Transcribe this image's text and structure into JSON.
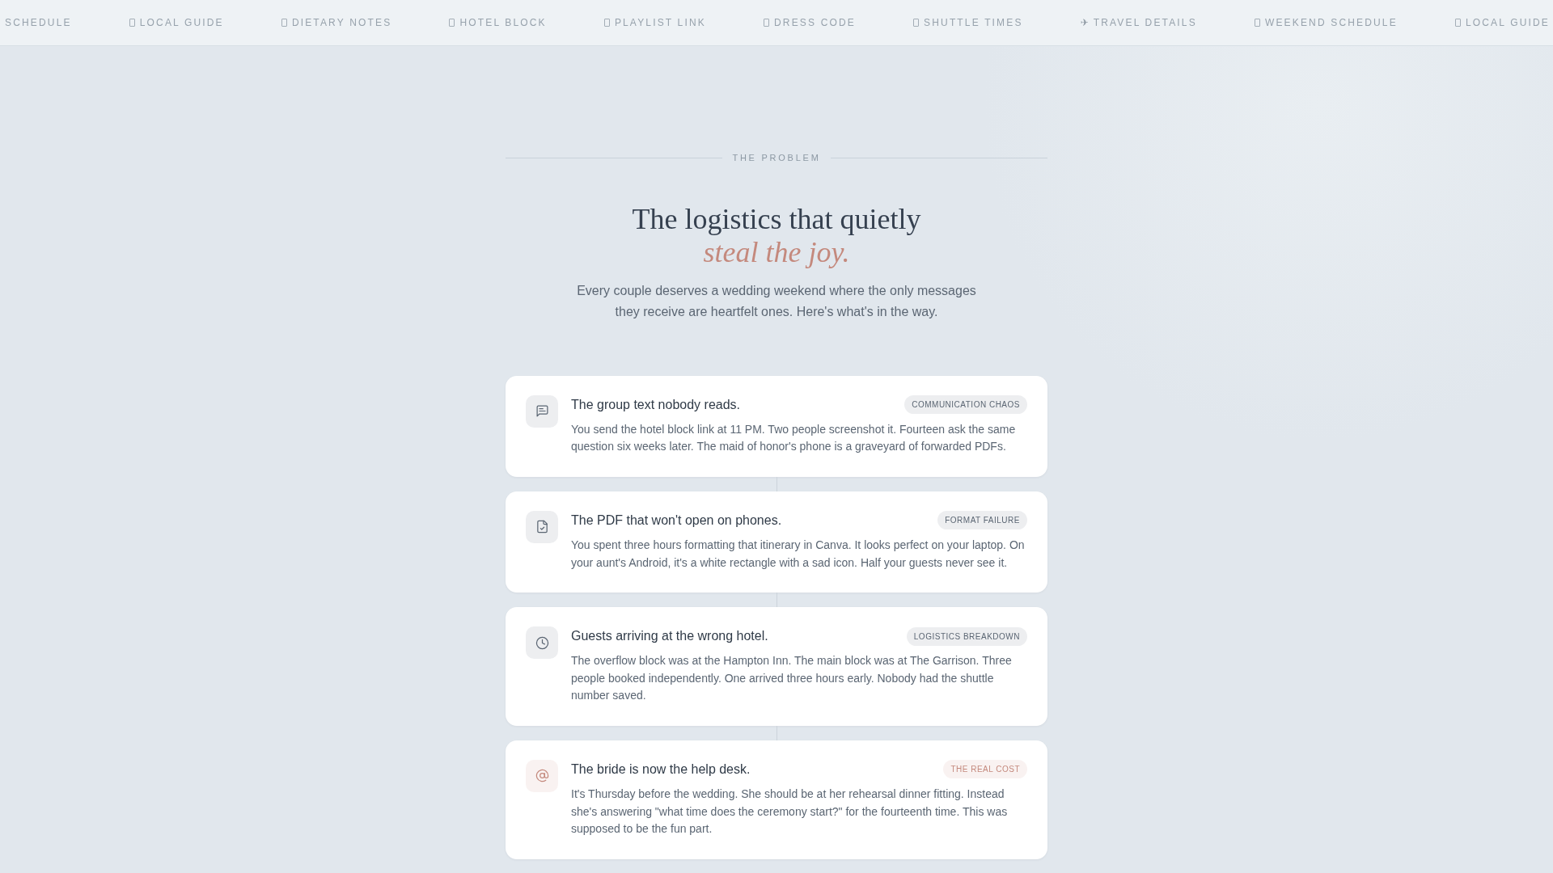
{
  "ticker": {
    "items": [
      {
        "label": "SCHEDULE",
        "kind": "text"
      },
      {
        "label": "LOCAL GUIDE",
        "kind": "box"
      },
      {
        "label": "DIETARY NOTES",
        "kind": "box"
      },
      {
        "label": "HOTEL BLOCK",
        "kind": "box"
      },
      {
        "label": "PLAYLIST LINK",
        "kind": "box"
      },
      {
        "label": "DRESS CODE",
        "kind": "box"
      },
      {
        "label": "SHUTTLE TIMES",
        "kind": "box"
      },
      {
        "label": "TRAVEL DETAILS",
        "kind": "glyph",
        "glyph": "✈"
      },
      {
        "label": "WEEKEND SCHEDULE",
        "kind": "box"
      },
      {
        "label": "LOCAL GUIDE",
        "kind": "box"
      }
    ]
  },
  "section": {
    "eyebrow": "THE PROBLEM",
    "heading": "The logistics that quietly",
    "heading_accent": "steal the joy.",
    "intro": "Every couple deserves a wedding weekend where the only messages they receive are heartfelt ones. Here's what's in the way."
  },
  "cards": [
    {
      "title": "The group text nobody reads.",
      "tag": "COMMUNICATION CHAOS",
      "color": "#5b6673",
      "text": "You send the hotel block link at 11 PM. Two people screenshot it. Fourteen ask the same question six weeks later. The maid of honor's phone is a graveyard of forwarded PDFs."
    },
    {
      "title": "The PDF that won't open on phones.",
      "tag": "FORMAT FAILURE",
      "color": "#5b6673",
      "text": "You spent three hours formatting that itinerary in Canva. It looks perfect on your laptop. On your aunt's Android, it's a white rectangle with a sad icon. Half your guests never see it."
    },
    {
      "title": "Guests arriving at the wrong hotel.",
      "tag": "LOGISTICS BREAKDOWN",
      "color": "#5b6673",
      "text": "The overflow block was at the Hampton Inn. The main block was at The Garrison. Three people booked independently. One arrived three hours early. Nobody had the shuttle number saved."
    },
    {
      "title": "The bride is now the help desk.",
      "tag": "THE REAL COST",
      "color": "#c4897d",
      "text": "It's Thursday before the wedding. She should be at her rehearsal dinner fitting. Instead she's answering \"what time does the ceremony start?\" for the fourteenth time. This was supposed to be the fun part."
    }
  ]
}
